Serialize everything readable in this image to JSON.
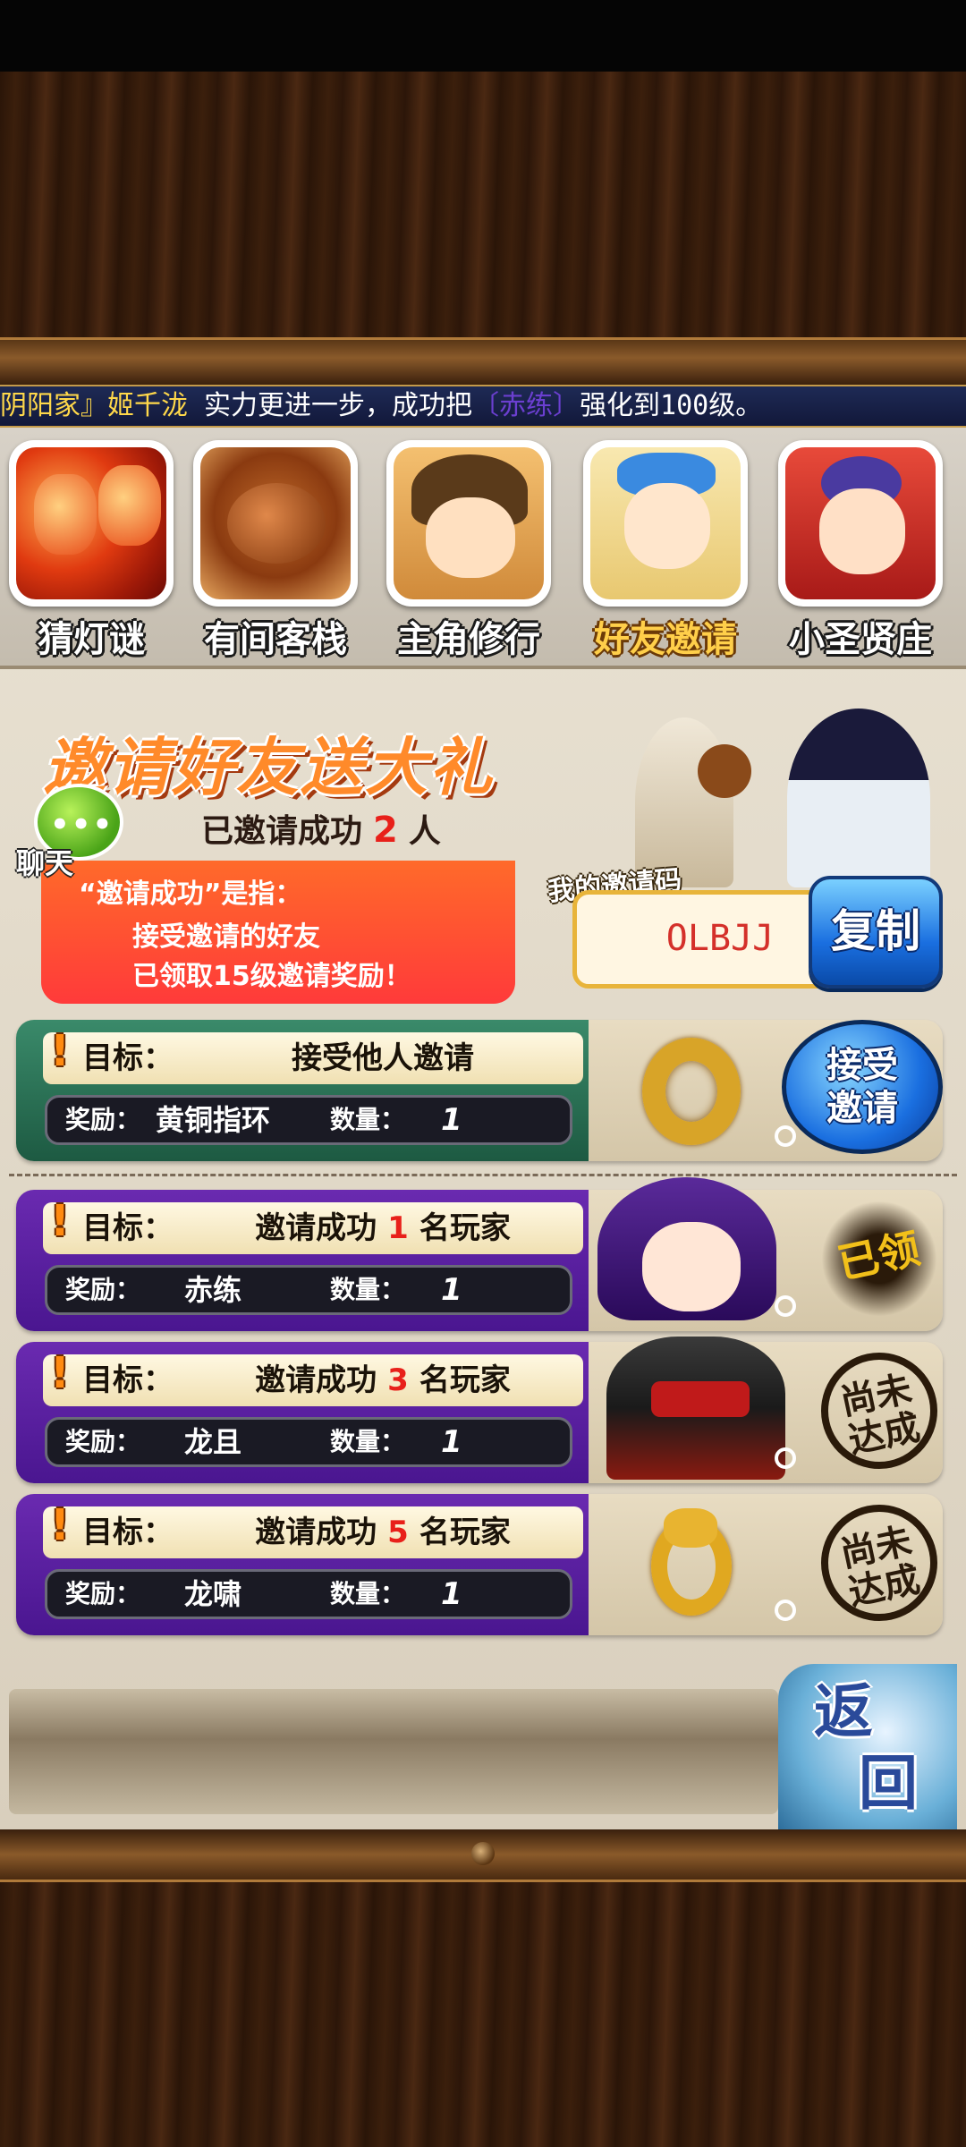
{
  "ticker": {
    "name": "阴阳家』姬千泷",
    "text": " 实力更进一步，成功把",
    "item": "〔赤练〕",
    "text2": "强化到100级。"
  },
  "tabs": [
    {
      "label": "猜灯谜",
      "active": false
    },
    {
      "label": "有间客栈",
      "active": false
    },
    {
      "label": "主角修行",
      "active": false
    },
    {
      "label": "好友邀请",
      "active": true
    },
    {
      "label": "小圣贤庄",
      "active": false
    }
  ],
  "banner": {
    "title": "邀请好友送大礼",
    "invited_prefix": "已邀请成功",
    "invited_count": "2",
    "invited_suffix": "人",
    "rule_line1": "“邀请成功”是指：",
    "rule_line2": "接受邀请的好友",
    "rule_line3": "已领取15级邀请奖励！"
  },
  "chat": {
    "label": "聊天"
  },
  "invite_code": {
    "label": "我的邀请码",
    "code": "OLBJJ",
    "copy_label": "复制"
  },
  "tasks": [
    {
      "goal_label": "目标：",
      "goal_text": "接受他人邀请",
      "goal_num": "",
      "goal_suffix": "",
      "reward_label": "奖励：",
      "reward_item": "黄铜指环",
      "qty_label": "数量：",
      "qty": "1",
      "action": "接受邀请",
      "status": "button"
    },
    {
      "goal_label": "目标：",
      "goal_text": "邀请成功",
      "goal_num": "1",
      "goal_suffix": "名玩家",
      "reward_label": "奖励：",
      "reward_item": "赤练",
      "qty_label": "数量：",
      "qty": "1",
      "action": "已领",
      "status": "claimed"
    },
    {
      "goal_label": "目标：",
      "goal_text": "邀请成功",
      "goal_num": "3",
      "goal_suffix": "名玩家",
      "reward_label": "奖励：",
      "reward_item": "龙且",
      "qty_label": "数量：",
      "qty": "1",
      "action": "尚未达成",
      "status": "pending"
    },
    {
      "goal_label": "目标：",
      "goal_text": "邀请成功",
      "goal_num": "5",
      "goal_suffix": "名玩家",
      "reward_label": "奖励：",
      "reward_item": "龙啸",
      "qty_label": "数量：",
      "qty": "1",
      "action": "尚未达成",
      "status": "pending"
    }
  ],
  "back": {
    "char1": "返",
    "char2": "回"
  }
}
